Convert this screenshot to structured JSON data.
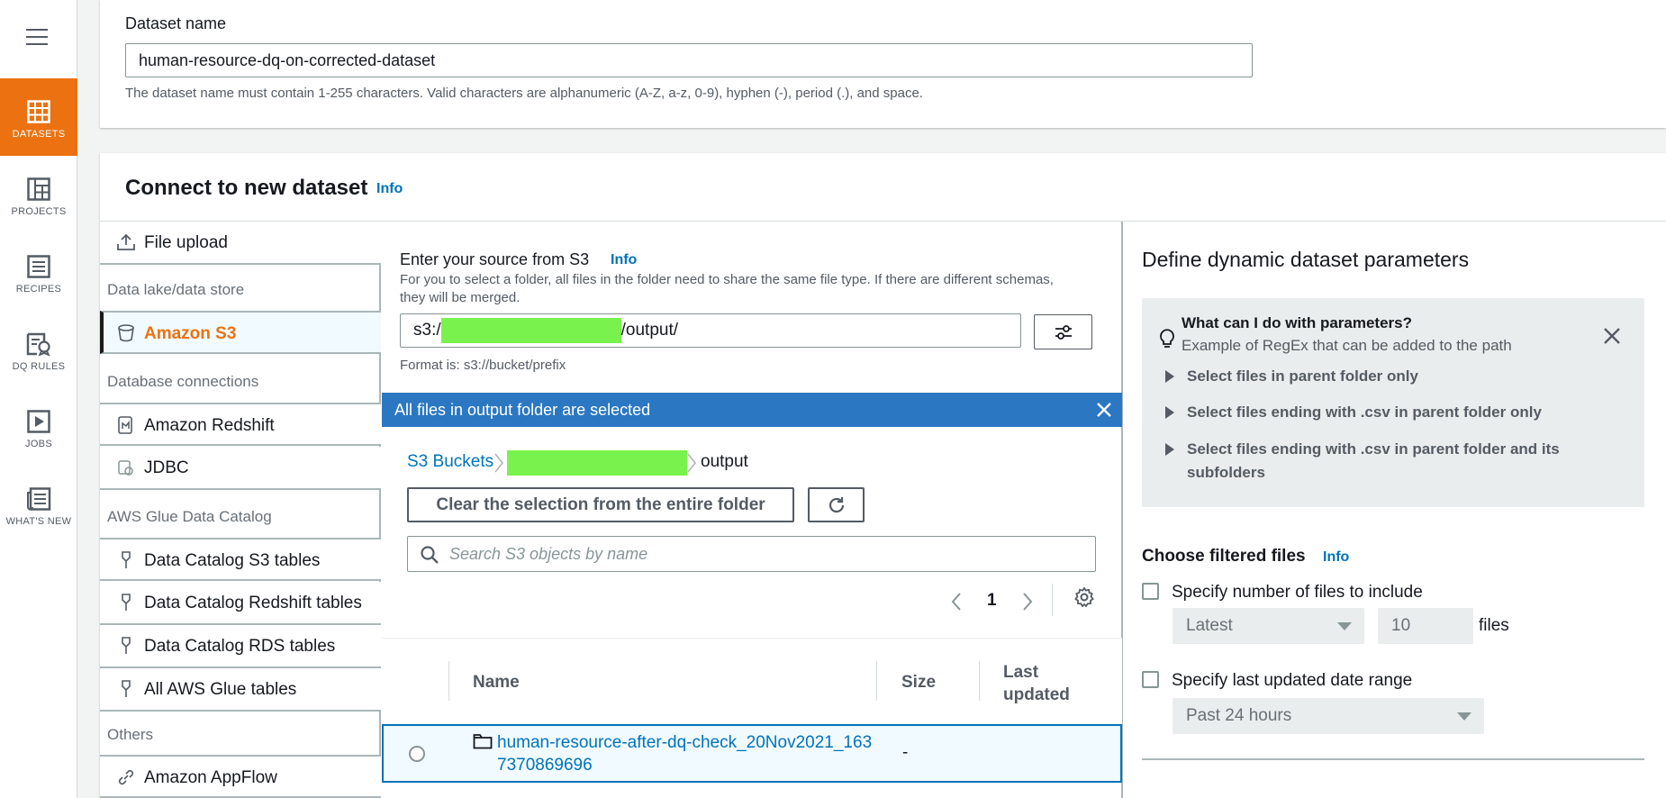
{
  "rail": {
    "items": [
      {
        "label": "DATASETS",
        "icon": "table-grid-icon",
        "active": true
      },
      {
        "label": "PROJECTS",
        "icon": "project-board-icon"
      },
      {
        "label": "RECIPES",
        "icon": "recipe-list-icon"
      },
      {
        "label": "DQ RULES",
        "icon": "dq-rules-icon"
      },
      {
        "label": "JOBS",
        "icon": "play-job-icon"
      },
      {
        "label": "WHAT'S NEW",
        "icon": "newspaper-icon"
      }
    ]
  },
  "dataset_name": {
    "label": "Dataset name",
    "value": "human-resource-dq-on-corrected-dataset",
    "hint": "The dataset name must contain 1-255 characters. Valid characters are alphanumeric (A-Z, a-z, 0-9), hyphen (-), period (.), and space."
  },
  "connect": {
    "title": "Connect to new dataset",
    "info": "Info",
    "sources": {
      "file_upload": "File upload",
      "group_lake": "Data lake/data store",
      "amazon_s3": "Amazon S3",
      "group_db": "Database connections",
      "redshift": "Amazon Redshift",
      "jdbc": "JDBC",
      "group_glue": "AWS Glue Data Catalog",
      "catalog_s3": "Data Catalog S3 tables",
      "catalog_redshift": "Data Catalog Redshift tables",
      "catalog_rds": "Data Catalog RDS tables",
      "all_glue": "All AWS Glue tables",
      "group_others": "Others",
      "appflow": "Amazon AppFlow"
    }
  },
  "s3": {
    "label": "Enter your source from S3",
    "info": "Info",
    "desc": "For you to select a folder, all files in the folder need to share the same file type. If there are different schemas, they will be merged.",
    "path_prefix": "s3:/",
    "path_suffix": "/output/",
    "format_hint": "Format is: s3://bucket/prefix",
    "banner": "All files in output folder are selected",
    "breadcrumb_root": "S3 Buckets",
    "breadcrumb_current": "output",
    "clear_button": "Clear the selection from the entire folder",
    "search_placeholder": "Search S3 objects by name",
    "page": "1",
    "columns": {
      "name": "Name",
      "size": "Size",
      "last_updated": "Last updated"
    },
    "rows": [
      {
        "name": "human-resource-after-dq-check_20Nov2021_1637370869696",
        "size": "-",
        "last_updated": ""
      }
    ]
  },
  "params": {
    "title": "Define dynamic dataset parameters",
    "help_title": "What can I do with parameters?",
    "help_sub": "Example of RegEx that can be added to the path",
    "help_items": [
      "Select files in parent folder only",
      "Select files ending with .csv in parent folder only",
      "Select files ending with .csv in parent folder and its subfolders"
    ],
    "filtered_title": "Choose filtered files",
    "info": "Info",
    "opt_count": "Specify number of files to include",
    "count_select": "Latest",
    "count_value": "10",
    "count_unit": "files",
    "opt_date": "Specify last updated date range",
    "date_select": "Past 24 hours"
  },
  "colors": {
    "accent": "#ec7211",
    "link": "#0073bb",
    "banner": "#2b77c2",
    "redaction": "#79f24e"
  }
}
